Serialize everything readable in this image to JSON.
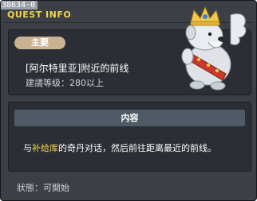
{
  "window": {
    "id_label": "38634-0",
    "title": "QUEST INFO"
  },
  "quest": {
    "category": "主要",
    "name": "[阿尔特里亚]附近的前线",
    "level_requirement": "建議等级：280以上"
  },
  "content": {
    "header": "内容",
    "text_before": "与",
    "highlight": "补给库",
    "text_after": "的奇丹对话，然后前往距离最近的前线。"
  },
  "status": "狀態：可開始",
  "colors": {
    "title": "#f3d44a",
    "badge": "#cbb192",
    "highlight": "#f3d44a",
    "panel": "#2b2f35",
    "header_bar": "#4f5a66"
  },
  "npc_illustration": "knight-dog-npc-icon"
}
